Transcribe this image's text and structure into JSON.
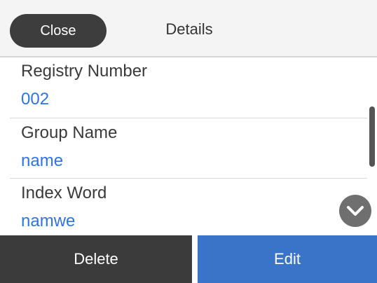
{
  "header": {
    "close_label": "Close",
    "title": "Details"
  },
  "fields": [
    {
      "label": "Registry Number",
      "value": "002"
    },
    {
      "label": "Group Name",
      "value": "name"
    },
    {
      "label": "Index Word",
      "value": "namwe"
    }
  ],
  "scroll": {
    "down_icon": "chevron-down-icon"
  },
  "footer": {
    "delete_label": "Delete",
    "edit_label": "Edit"
  },
  "colors": {
    "value_text": "#2d74e6",
    "edit_button": "#3a74c8",
    "delete_button": "#3b3b3b",
    "close_button": "#3d3d3d"
  }
}
